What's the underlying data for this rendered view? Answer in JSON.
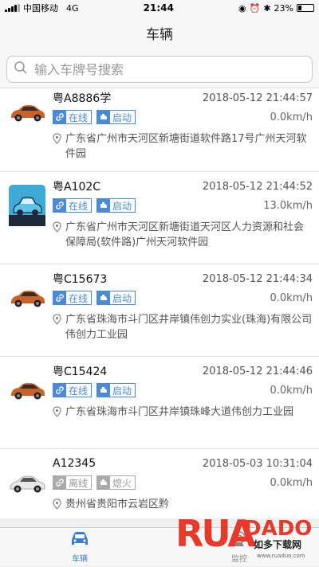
{
  "status_bar": {
    "carrier": "中国移动",
    "network": "4G",
    "time": "21:44",
    "battery": "23%",
    "battery_level": 0.23
  },
  "nav": {
    "title": "车辆"
  },
  "search": {
    "placeholder": "输入车牌号搜索"
  },
  "vehicles": [
    {
      "plate": "粤A8886学",
      "time": "2018-05-12 21:44:57",
      "status": "在线",
      "engine": "启动",
      "speed": "0.0km/h",
      "address": "广东省广州市天河区新塘街道软件路17号广州天河软件园",
      "icon": "orange-suv-icon",
      "online": true
    },
    {
      "plate": "粤A102C",
      "time": "2018-05-12 21:44:52",
      "status": "在线",
      "engine": "启动",
      "speed": "13.0km/h",
      "address": "广东省广州市天河区新塘街道天河区人力资源和社会保障局(软件路)广州天河软件园",
      "icon": "blue-car-icon",
      "online": true
    },
    {
      "plate": "粤C15673",
      "time": "2018-05-12 21:44:34",
      "status": "在线",
      "engine": "启动",
      "speed": "0.0km/h",
      "address": "广东省珠海市斗门区井岸镇伟创力实业(珠海)有限公司伟创力工业园",
      "icon": "orange-suv-icon",
      "online": true
    },
    {
      "plate": "粤C15424",
      "time": "2018-05-12 21:44:46",
      "status": "在线",
      "engine": "启动",
      "speed": "0.0km/h",
      "address": "广东省珠海市斗门区井岸镇珠峰大道伟创力工业园",
      "icon": "orange-suv-icon",
      "online": true
    },
    {
      "plate": "A12345",
      "time": "2018-05-03 10:31:04",
      "status": "离线",
      "engine": "熄火",
      "speed": "0.0km/h",
      "address": "贵州省贵阳市云岩区黔",
      "icon": "white-sedan-icon",
      "online": false
    }
  ],
  "tabs": [
    {
      "label": "车辆",
      "icon": "car-icon",
      "active": true
    },
    {
      "label": "监控",
      "icon": "camera-icon",
      "active": false
    }
  ],
  "watermark": {
    "brand": "RUANDADO",
    "sub": "如多下载网",
    "url": "www.ruaduo.com"
  },
  "colors": {
    "accent": "#4a8ad8",
    "tab_active": "#3a7bd5",
    "offline": "#aaaaaa"
  }
}
